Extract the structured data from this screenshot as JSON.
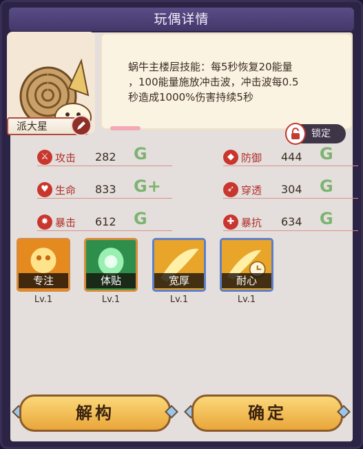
{
  "window": {
    "title": "玩偶详情"
  },
  "doll": {
    "name": "派大星",
    "skill_desc_lines": [
      "蜗牛主楼层技能：每5秒恢复20能量",
      "，100能量施放冲击波，冲击波每0.5",
      "秒造成1000%伤害持续5秒"
    ]
  },
  "lock": {
    "label": "锁定"
  },
  "stats": [
    {
      "label": "攻击",
      "value": "282",
      "grade": "G",
      "icon": "sword-icon"
    },
    {
      "label": "防御",
      "value": "444",
      "grade": "G",
      "icon": "shield-icon"
    },
    {
      "label": "生命",
      "value": "833",
      "grade": "G+",
      "icon": "heart-icon"
    },
    {
      "label": "穿透",
      "value": "304",
      "grade": "G",
      "icon": "pierce-icon"
    },
    {
      "label": "暴击",
      "value": "612",
      "grade": "G",
      "icon": "crit-icon"
    },
    {
      "label": "暴抗",
      "value": "634",
      "grade": "G",
      "icon": "crit-resist-icon"
    }
  ],
  "skills": [
    {
      "name": "专注",
      "level": "Lv.1",
      "color": "#d98a3b"
    },
    {
      "name": "体贴",
      "level": "Lv.1",
      "color": "#d98a3b"
    },
    {
      "name": "宽厚",
      "level": "Lv.1",
      "color": "#5f7ec8"
    },
    {
      "name": "耐心",
      "level": "Lv.1",
      "color": "#5f7ec8"
    }
  ],
  "buttons": {
    "dismantle": "解构",
    "confirm": "确定"
  }
}
